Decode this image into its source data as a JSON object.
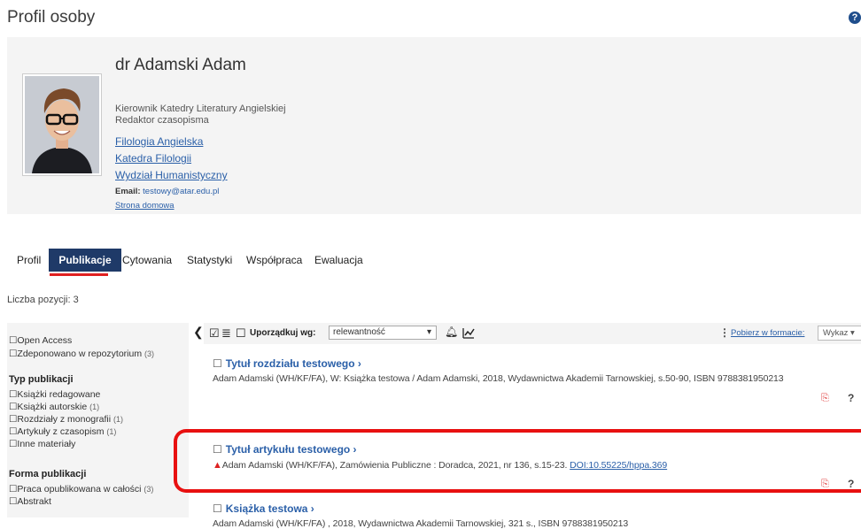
{
  "page": {
    "title": "Profil osoby"
  },
  "profile": {
    "name": "dr Adamski Adam",
    "roles": [
      "Kierownik Katedry Literatury Angielskiej",
      "Redaktor czasopisma"
    ],
    "units": [
      "Filologia Angielska",
      "Katedra Filologii",
      "Wydział Humanistyczny"
    ],
    "email_label": "Email:",
    "email": "testowy@atar.edu.pl",
    "homepage": "Strona domowa"
  },
  "tabs": [
    "Profil",
    "Publikacje",
    "Cytowania",
    "Statystyki",
    "Współpraca",
    "Ewaluacja"
  ],
  "count_label": "Liczba pozycji: 3",
  "filters": {
    "top": [
      {
        "label": "Open Access",
        "count": ""
      },
      {
        "label": "Zdeponowano w repozytorium",
        "count": "(3)"
      }
    ],
    "type_heading": "Typ publikacji",
    "type_items": [
      {
        "label": "Książki redagowane",
        "count": ""
      },
      {
        "label": "Książki autorskie",
        "count": "(1)"
      },
      {
        "label": "Rozdziały z monografii",
        "count": "(1)"
      },
      {
        "label": "Artykuły z czasopism",
        "count": "(1)"
      },
      {
        "label": "Inne materiały",
        "count": ""
      }
    ],
    "form_heading": "Forma publikacji",
    "form_items": [
      {
        "label": "Praca opublikowana w całości",
        "count": "(3)"
      },
      {
        "label": "Abstrakt",
        "count": ""
      }
    ]
  },
  "toolbar": {
    "sort_label": "Uporządkuj wg:",
    "sort_value": "relewantność",
    "download_label": "Pobierz w formacie:",
    "format_value": "Wykaz"
  },
  "publications": [
    {
      "title": "Tytuł rozdziału testowego ›",
      "meta": "Adam Adamski (WH/KF/FA), W: Książka testowa / Adam Adamski, 2018, Wydawnictwa Akademii Tarnowskiej, s.50-90, ISBN 9788381950213",
      "doi": ""
    },
    {
      "title": "Tytuł artykułu testowego ›",
      "meta": "Adam Adamski (WH/KF/FA), Zamówienia Publiczne : Doradca, 2021, nr 136, s.15-23.",
      "doi": "DOI:10.55225/hppa.369"
    },
    {
      "title": "Książka testowa ›",
      "meta": "Adam Adamski (WH/KF/FA) , 2018, Wydawnictwa Akademii Tarnowskiej, 321 s., ISBN 9788381950213",
      "doi": ""
    }
  ]
}
